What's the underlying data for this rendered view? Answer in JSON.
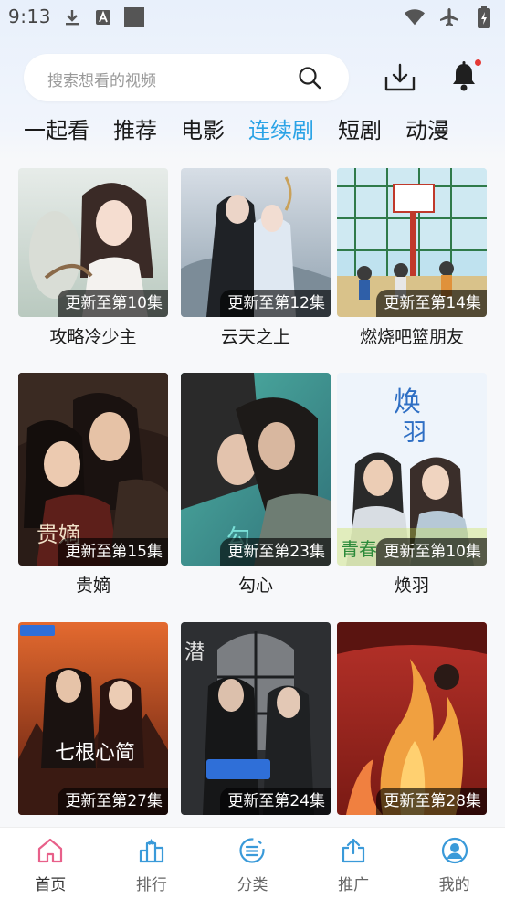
{
  "status_bar": {
    "time": "9:13"
  },
  "search": {
    "placeholder": "搜索想看的视频"
  },
  "tabs": [
    {
      "label": "一起看"
    },
    {
      "label": "推荐"
    },
    {
      "label": "电影"
    },
    {
      "label": "连续剧",
      "active": true
    },
    {
      "label": "短剧"
    },
    {
      "label": "动漫"
    }
  ],
  "videos": [
    {
      "title": "攻略冷少主",
      "badge": "更新至第10集"
    },
    {
      "title": "云天之上",
      "badge": "更新至第12集"
    },
    {
      "title": "燃烧吧篮朋友",
      "badge": "更新至第14集"
    },
    {
      "title": "贵嫡",
      "badge": "更新至第15集"
    },
    {
      "title": "勾心",
      "badge": "更新至第23集"
    },
    {
      "title": "焕羽",
      "badge": "更新至第10集"
    },
    {
      "title": "",
      "badge": "更新至第27集"
    },
    {
      "title": "",
      "badge": "更新至第24集"
    },
    {
      "title": "",
      "badge": "更新至第28集"
    }
  ],
  "bottom_nav": [
    {
      "label": "首页",
      "icon": "home-icon",
      "active": true
    },
    {
      "label": "排行",
      "icon": "ranking-icon"
    },
    {
      "label": "分类",
      "icon": "category-icon"
    },
    {
      "label": "推广",
      "icon": "share-icon"
    },
    {
      "label": "我的",
      "icon": "profile-icon"
    }
  ],
  "colors": {
    "accent": "#2aa3e6",
    "home_active": "#e8608a",
    "icon_blue": "#3a9ad9",
    "notification_dot": "#e53935"
  }
}
